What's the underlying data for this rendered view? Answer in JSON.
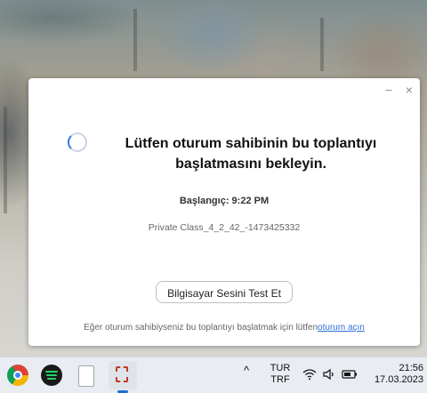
{
  "dialog": {
    "minimize_icon": "–",
    "close_icon": "×",
    "message_line1": "Lütfen oturum sahibinin bu toplantıyı",
    "message_line2": "başlatmasını bekleyin.",
    "start_time": "Başlangıç: 9:22 PM",
    "meeting_name": "Private Class_4_2_42_-1473425332",
    "test_audio_button": "Bilgisayar Sesini Test Et",
    "footer_text": "Eğer oturum sahibiyseniz bu toplantıyı başlatmak için lütfen",
    "footer_link": "oturum açın"
  },
  "taskbar": {
    "apps": [
      "chrome-icon",
      "spotify-icon",
      "file-icon",
      "snipping-tool-icon"
    ],
    "overflow_chevron": "^",
    "language_line1": "TUR",
    "language_line2": "TRF",
    "time": "21:56",
    "date": "17.03.2023"
  },
  "colors": {
    "accent": "#2d7bdf",
    "link": "#2d6ed8",
    "taskbar_bg": "#e9ecf2"
  }
}
